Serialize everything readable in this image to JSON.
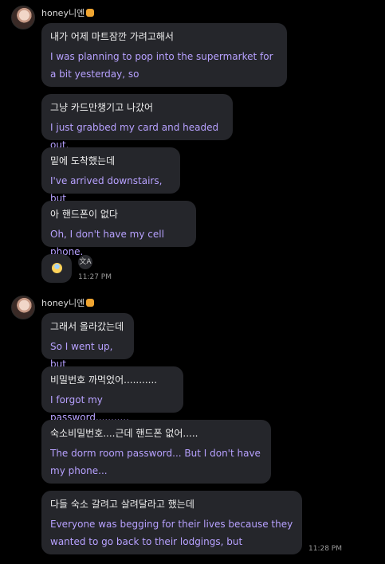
{
  "groups": [
    {
      "sender": {
        "name": "honey니엔",
        "emoji_icon": "devil-emoji-icon"
      },
      "messages": [
        {
          "original": "내가 어제 마트잠깐 가려고해서",
          "translation": "I was planning to pop into the supermarket for a bit yesterday, so"
        },
        {
          "original": "그냥 카드만챙기고 나갔어",
          "translation": "I just grabbed my card and headed out."
        },
        {
          "original": "밑에 도착했는데",
          "translation": "I've arrived downstairs, but"
        },
        {
          "original": "아 핸드폰이 없다",
          "translation": "Oh, I don't have my cell phone."
        }
      ],
      "reaction": {
        "icon": "anxious-face-emoji-icon"
      },
      "translate_icon": "translate-icon",
      "translate_glyph": "文A",
      "time": "11:27 PM"
    },
    {
      "sender": {
        "name": "honey니엔",
        "emoji_icon": "devil-emoji-icon"
      },
      "messages": [
        {
          "original": "그래서 올라갔는데",
          "translation": "So I went up, but"
        },
        {
          "original": "비밀번호 까먹었어...........",
          "translation": "I forgot my password..........."
        },
        {
          "original": "숙소비밀번호....근데 핸드폰 없어.....",
          "translation": "The dorm room password... But I don't have my phone..."
        },
        {
          "original": "다들 숙소 갈려고 살려달라고 했는데",
          "translation": "Everyone was begging for their lives because they wanted to go back to their lodgings, but"
        }
      ],
      "time": "11:28 PM"
    }
  ],
  "colors": {
    "background": "#000000",
    "bubble": "#25262b",
    "translation_text": "#b7a1ff",
    "original_text": "#ededed",
    "timestamp": "#9a9a9a"
  }
}
